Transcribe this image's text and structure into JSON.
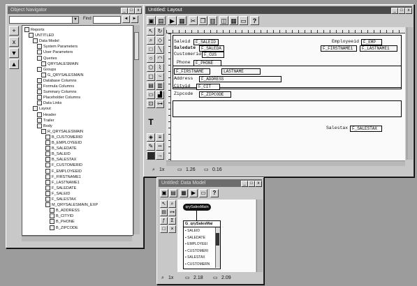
{
  "object_navigator": {
    "title": "Object Navigator",
    "find_label": "Find",
    "tree": [
      {
        "label": "Reports",
        "level": 0
      },
      {
        "label": "UNTITLED",
        "level": 1
      },
      {
        "label": "Data Model",
        "level": 2
      },
      {
        "label": "System Parameters",
        "level": 3
      },
      {
        "label": "User Parameters",
        "level": 3
      },
      {
        "label": "Queries",
        "level": 3
      },
      {
        "label": "QRYSALESMAIN",
        "level": 4
      },
      {
        "label": "Groups",
        "level": 3
      },
      {
        "label": "G_QRYSALESMAIN",
        "level": 4
      },
      {
        "label": "Database Columns",
        "level": 3
      },
      {
        "label": "Formula Columns",
        "level": 3
      },
      {
        "label": "Summary Columns",
        "level": 3
      },
      {
        "label": "Placeholder Columns",
        "level": 3
      },
      {
        "label": "Data Links",
        "level": 3
      },
      {
        "label": "Layout",
        "level": 2
      },
      {
        "label": "Header",
        "level": 3
      },
      {
        "label": "Trailer",
        "level": 3
      },
      {
        "label": "Body",
        "level": 3
      },
      {
        "label": "R_QRYSALESMAIN",
        "level": 4
      },
      {
        "label": "B_CUSTOMERID",
        "level": 5
      },
      {
        "label": "B_EMPLOYEEID",
        "level": 5
      },
      {
        "label": "B_SALEDATE",
        "level": 5
      },
      {
        "label": "B_SALEID",
        "level": 5
      },
      {
        "label": "B_SALESTAX",
        "level": 5
      },
      {
        "label": "F_CUSTOMERID",
        "level": 5
      },
      {
        "label": "F_EMPLOYEEID",
        "level": 5
      },
      {
        "label": "F_FIRSTNAME1",
        "level": 5
      },
      {
        "label": "F_LASTNAME1",
        "level": 5
      },
      {
        "label": "F_SALEDATE",
        "level": 5
      },
      {
        "label": "F_SALEID",
        "level": 5
      },
      {
        "label": "F_SALESTAX",
        "level": 5
      },
      {
        "label": "M_QRYSALESMAIN_EXP",
        "level": 5
      },
      {
        "label": "B_ADDRESS",
        "level": 6
      },
      {
        "label": "B_CITYID",
        "level": 6
      },
      {
        "label": "B_PHONE",
        "level": 6
      },
      {
        "label": "B_ZIPCODE",
        "level": 6
      }
    ]
  },
  "layout": {
    "title": "Untitled: Layout",
    "labels": {
      "saleid": "Saleid",
      "saledate": "Saledate",
      "customerid": "Customerid",
      "phone": "Phone",
      "address": "Address",
      "cityid": "Cityid",
      "zipcode": "Zipcode",
      "salestax": "Salestax",
      "employeeid": "Employeeid"
    },
    "fields": {
      "saleid": "F_SALEID",
      "saledate": "F_SALEDA",
      "customerid": "F_CUS",
      "phone": "F_PHONE",
      "firstname": "F_FIRSTNAME",
      "lastname": "LASTNAME",
      "address": "F_ADDRESS",
      "cityid": "F_CIT",
      "zipcode": "F_ZIPCODE",
      "salestax": "F_SALESTAX",
      "employeeid": "F_EMP",
      "firstname1": "F_FIRSTNAME1",
      "lastname1": "F_LASTNAME1"
    },
    "status": {
      "zoom": "1x",
      "pos1": "1.26",
      "pos2": "0.16"
    }
  },
  "data_model": {
    "title": "Untitled: Data Model",
    "query_name": "qrySalesMain",
    "group_name": "G_qrySalesMai",
    "columns": [
      "SALEID",
      "SALEDATE",
      "EMPLOYEEI",
      "CUSTOMERI",
      "SALESTAX",
      "CUSTOMERN"
    ],
    "status": {
      "zoom": "1x",
      "pos1": "2.18",
      "pos2": "2.09"
    }
  }
}
